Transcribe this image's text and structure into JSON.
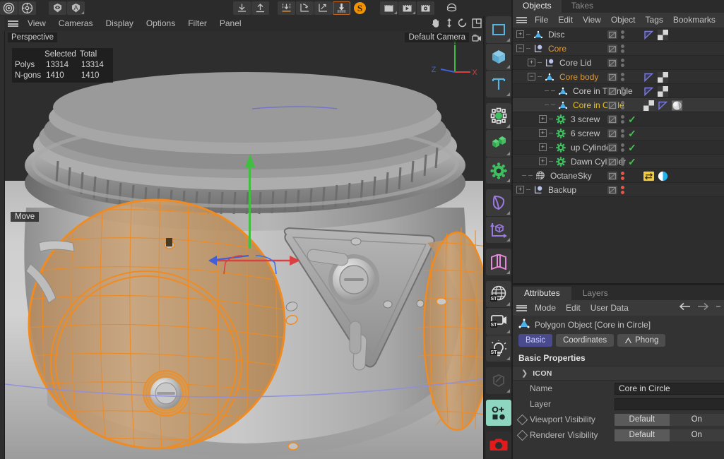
{
  "app": {
    "top_toolbar": {
      "left_icons": [
        "circles-icon",
        "gear-circle-icon"
      ],
      "left_icons2": [
        "eye-shield-icon",
        "letter-a-icon"
      ],
      "mid_icons": [
        "import-down-icon",
        "export-up-icon",
        "snap-axis-icon",
        "axis-rotate-icon",
        "axis-scale-icon",
        "deform-down-icon",
        "octane-s-icon"
      ],
      "right_icons": [
        "render-view-icon",
        "render-play-icon",
        "render-settings-icon",
        "render-circle-icon"
      ],
      "nav_icons": [
        "hand-pan-icon",
        "zoom-dolly-icon",
        "rotate-orbit-icon",
        "viewport-layout-icon"
      ]
    }
  },
  "viewport": {
    "menu": {
      "hamburger": "hamburger-icon",
      "items": [
        "View",
        "Cameras",
        "Display",
        "Options",
        "Filter",
        "Panel"
      ]
    },
    "label_left": "Perspective",
    "label_right": "Default Camera",
    "camera_icon": "camera-lock-icon",
    "stats": {
      "col_headers": [
        "",
        "Selected",
        "Total"
      ],
      "rows": [
        {
          "label": "Polys",
          "selected": "13314",
          "total": "13314"
        },
        {
          "label": "N-gons",
          "selected": "1410",
          "total": "1410"
        }
      ]
    },
    "active_tool": "Move",
    "axis_gizmo": {
      "x": "X",
      "y": "Y",
      "z": "Z"
    },
    "colors": {
      "axis_x": "#d94040",
      "axis_y": "#3fbe3f",
      "axis_z": "#4060d9",
      "selection": "#ef8b21",
      "background": "#2e2e2e"
    }
  },
  "right_toolbar": {
    "items": [
      {
        "name": "rectangle-selection-icon"
      },
      {
        "name": "cube-primitive-icon"
      },
      {
        "name": "text-tool-icon"
      },
      {
        "name": "point-scale-icon"
      },
      {
        "name": "array-green-icon"
      },
      {
        "name": "gear-deformer-icon"
      },
      {
        "name": "bend-deformer-icon"
      },
      {
        "name": "axis-cube-icon"
      },
      {
        "name": "pink-fold-icon"
      },
      {
        "name": "octane-sky-icon"
      },
      {
        "name": "octane-camera-icon"
      },
      {
        "name": "octane-light-icon"
      },
      {
        "name": "edit-disabled-icon"
      },
      {
        "name": "add-object-icon"
      },
      {
        "name": "render-camera-icon"
      }
    ]
  },
  "object_manager": {
    "tabs": [
      {
        "label": "Objects",
        "active": true
      },
      {
        "label": "Takes",
        "active": false
      }
    ],
    "menu": {
      "hamburger": "hamburger-icon",
      "items": [
        "File",
        "Edit",
        "View",
        "Object",
        "Tags",
        "Bookmarks"
      ]
    },
    "rows": [
      {
        "name": "Disc",
        "depth": 0,
        "expander": "+",
        "icon": "polygon-object-icon",
        "name_color": "normal",
        "visibility": "dots",
        "tags": [
          "phong-tag-icon",
          "checker-material-icon"
        ]
      },
      {
        "name": "Core",
        "depth": 0,
        "expander": "-",
        "icon": "null-object-icon",
        "name_color": "orange",
        "visibility": "dots",
        "tags": []
      },
      {
        "name": "Core Lid",
        "depth": 1,
        "expander": "+",
        "icon": "null-object-icon",
        "name_color": "normal",
        "visibility": "dots",
        "tags": []
      },
      {
        "name": "Core body",
        "depth": 1,
        "expander": "-",
        "icon": "polygon-object-icon",
        "name_color": "orange",
        "visibility": "dots",
        "tags": [
          "phong-tag-icon",
          "checker-material-icon"
        ]
      },
      {
        "name": "Core in Triangle",
        "depth": 2,
        "expander": "",
        "icon": "polygon-object-icon",
        "name_color": "normal",
        "visibility": "dots",
        "tags": [
          "phong-tag-icon",
          "checker-material-icon"
        ]
      },
      {
        "name": "Core in Circle",
        "depth": 2,
        "expander": "",
        "icon": "polygon-object-icon",
        "name_color": "yellow",
        "visibility": "dots",
        "tags": [
          "checker-material-icon",
          "phong-tag-icon",
          "sphere-preview-icon"
        ],
        "selected": true
      },
      {
        "name": "3 screw",
        "depth": 2,
        "expander": "+",
        "icon": "cloner-gear-icon",
        "name_color": "normal",
        "visibility": "check",
        "tags": []
      },
      {
        "name": "6 screw",
        "depth": 2,
        "expander": "+",
        "icon": "cloner-gear-icon",
        "name_color": "normal",
        "visibility": "check",
        "tags": []
      },
      {
        "name": "up Cylinder",
        "depth": 2,
        "expander": "+",
        "icon": "cloner-gear-icon",
        "name_color": "normal",
        "visibility": "check",
        "tags": []
      },
      {
        "name": "Dawn Cylinder",
        "depth": 2,
        "expander": "+",
        "icon": "cloner-gear-icon",
        "name_color": "normal",
        "visibility": "check",
        "tags": []
      },
      {
        "name": "OctaneSky",
        "depth": 0,
        "expander": "",
        "icon": "octane-sky-object-icon",
        "name_color": "normal",
        "visibility": "reddots",
        "tags": [
          "octane-tag-yellow-icon",
          "octane-env-blue-icon"
        ]
      },
      {
        "name": "Backup",
        "depth": 0,
        "expander": "+",
        "icon": "null-object-icon",
        "name_color": "normal",
        "visibility": "reddots",
        "tags": []
      }
    ]
  },
  "attribute_manager": {
    "tabs": [
      {
        "label": "Attributes",
        "active": true
      },
      {
        "label": "Layers",
        "active": false
      }
    ],
    "menu": {
      "hamburger": "hamburger-icon",
      "items": [
        "Mode",
        "Edit",
        "User Data"
      ],
      "nav": [
        "back-arrow-icon",
        "forward-arrow-icon"
      ]
    },
    "object_title": "Polygon Object [Core in Circle]",
    "object_icon": "polygon-object-icon",
    "pills": [
      {
        "label": "Basic",
        "active": true
      },
      {
        "label": "Coordinates",
        "active": false
      },
      {
        "label": "Phong",
        "active": false,
        "icon": "phong-tag-icon"
      }
    ],
    "section_title": "Basic Properties",
    "group": {
      "chevron": "chevron-right-icon",
      "label": "ICON"
    },
    "fields": [
      {
        "label": "Name",
        "type": "text",
        "value": "Core in Circle",
        "has_keyframe": false
      },
      {
        "label": "Layer",
        "type": "text",
        "value": "",
        "has_keyframe": false
      },
      {
        "label": "Viewport Visibility",
        "type": "segment",
        "options": [
          "Default",
          "On"
        ],
        "selected": "Default",
        "has_keyframe": true
      },
      {
        "label": "Renderer Visibility",
        "type": "segment",
        "options": [
          "Default",
          "On"
        ],
        "selected": "Default",
        "has_keyframe": true
      }
    ]
  }
}
